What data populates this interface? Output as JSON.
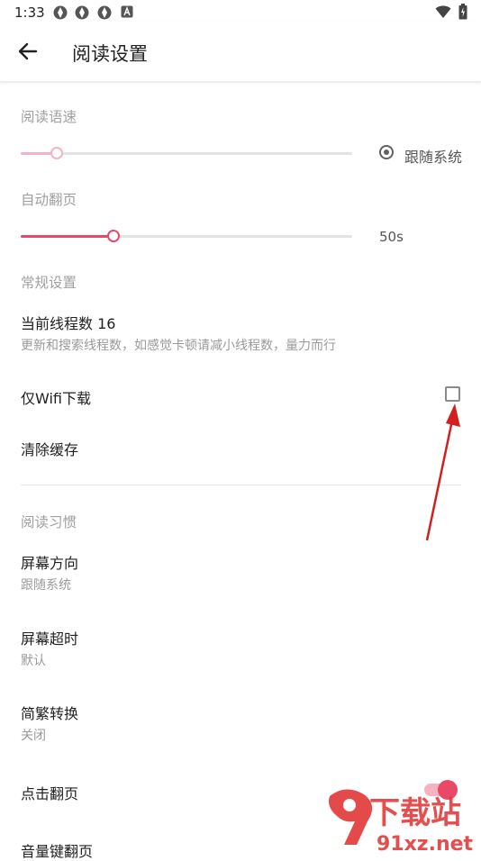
{
  "status_bar": {
    "time": "1:33"
  },
  "app_bar": {
    "title": "阅读设置"
  },
  "reading_speed": {
    "section_label": "阅读语速",
    "value_fraction": 0.11,
    "follow_system_label": "跟随系统",
    "follow_system_selected": true
  },
  "auto_page": {
    "section_label": "自动翻页",
    "value_fraction": 0.28,
    "value_label": "50s"
  },
  "general": {
    "section_label": "常规设置",
    "threads_title": "当前线程数 16",
    "threads_desc": "更新和搜索线程数，如感觉卡顿请减小线程数，量力而行",
    "wifi_only_label": "仅Wifi下载",
    "wifi_only_checked": false,
    "clear_cache_label": "清除缓存"
  },
  "habits": {
    "section_label": "阅读习惯",
    "screen_orientation": {
      "title": "屏幕方向",
      "value": "跟随系统"
    },
    "screen_timeout": {
      "title": "屏幕超时",
      "value": "默认"
    },
    "conversion": {
      "title": "简繁转换",
      "value": "关闭"
    },
    "tap_page_label": "点击翻页",
    "tap_page_on": true,
    "volume_key_label": "音量键翻页"
  },
  "watermark": {
    "text_cn": "下载站",
    "text_url": "91xz.net",
    "text_logo": "91"
  },
  "colors": {
    "accent": "#e94866",
    "accent_light": "#f5b3c2",
    "arrow": "#d21f1f"
  }
}
